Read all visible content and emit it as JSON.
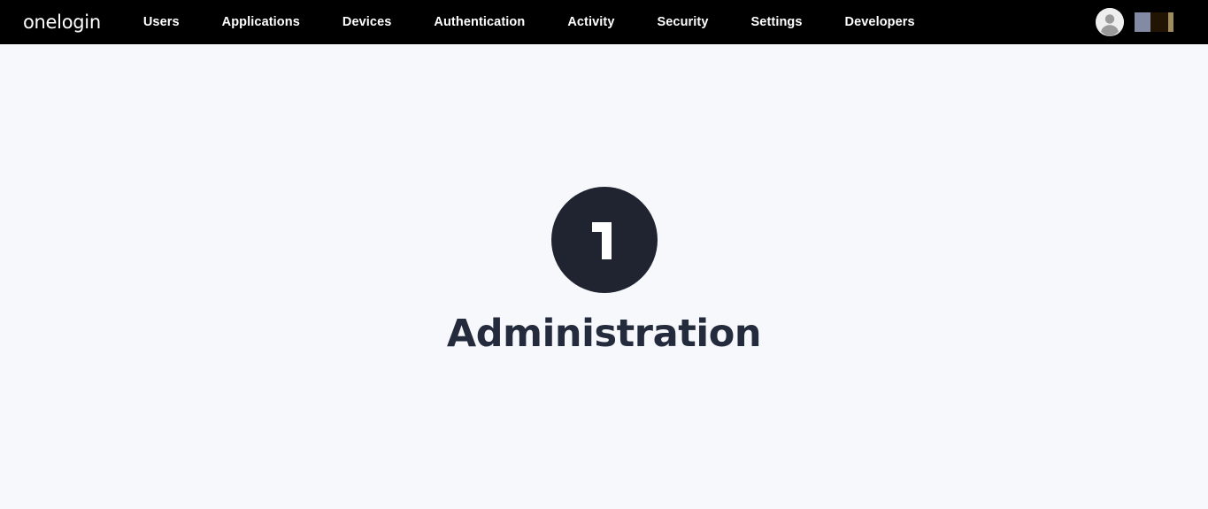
{
  "header": {
    "background_color": "#000000",
    "brand": {
      "wordmark": "onelogin",
      "icon": "onelogin-logo"
    },
    "nav_items": [
      {
        "label": "Users"
      },
      {
        "label": "Applications"
      },
      {
        "label": "Devices"
      },
      {
        "label": "Authentication"
      },
      {
        "label": "Activity"
      },
      {
        "label": "Security"
      },
      {
        "label": "Settings"
      },
      {
        "label": "Developers"
      }
    ],
    "account": {
      "avatar_icon": "user-avatar-icon"
    },
    "swatches": [
      {
        "name": "swatch-slate",
        "color": "#828ba3"
      },
      {
        "name": "swatch-dark-brown",
        "color": "#211403"
      },
      {
        "name": "swatch-tan",
        "color": "#a08b5f"
      }
    ]
  },
  "main": {
    "background_color": "#f6f8fb",
    "logo": {
      "icon": "onelogin-mark-icon",
      "glyph": "1",
      "circle_color": "#1f2430",
      "glyph_color": "#ffffff"
    },
    "title": "Administration",
    "title_color": "#242b3d"
  }
}
